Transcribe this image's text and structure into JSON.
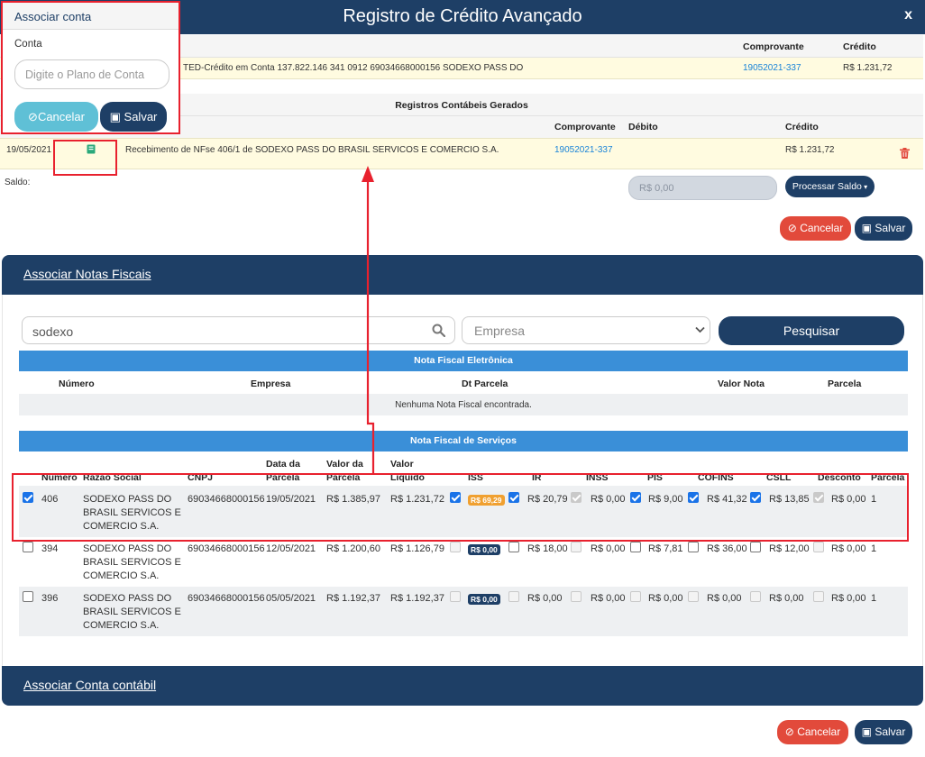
{
  "window": {
    "title": "Registro de Crédito Avançado",
    "close": "x"
  },
  "popup": {
    "title": "Associar conta",
    "field_label": "Conta",
    "placeholder": "Digite o Plano de Conta",
    "cancel": "Cancelar",
    "save": "Salvar"
  },
  "statement": {
    "headers": {
      "comprovante": "Comprovante",
      "credito": "Crédito"
    },
    "row": {
      "description": "TED-Crédito em Conta 137.822.146 341 0912 69034668000156 SODEXO PASS DO",
      "comprovante": "19052021-337",
      "credito": "R$ 1.231,72"
    }
  },
  "registros": {
    "title": "Registros Contábeis Gerados",
    "headers": {
      "comprovante": "Comprovante",
      "debito": "Débito",
      "credito": "Crédito"
    },
    "row": {
      "date": "19/05/2021",
      "description": "Recebimento de NFse 406/1 de SODEXO PASS DO BRASIL SERVICOS E COMERCIO S.A.",
      "comprovante": "19052021-337",
      "credito": "R$ 1.231,72"
    },
    "saldo_label": "Saldo:",
    "saldo_value": "R$ 0,00",
    "processar": "Processar Saldo",
    "cancel": "Cancelar",
    "save": "Salvar"
  },
  "notas": {
    "section_title": "Associar Notas Fiscais",
    "search_value": "sodexo",
    "empresa_placeholder": "Empresa",
    "search_button": "Pesquisar",
    "nfe": {
      "title": "Nota Fiscal Eletrônica",
      "headers": {
        "numero": "Número",
        "empresa": "Empresa",
        "dt_parcela": "Dt Parcela",
        "valor_nota": "Valor Nota",
        "parcela": "Parcela"
      },
      "empty": "Nenhuma Nota Fiscal encontrada."
    },
    "nfs": {
      "title": "Nota Fiscal de Serviços",
      "headers": {
        "numero": "Número",
        "razao": "Razão Social",
        "cnpj": "CNPJ",
        "data_1": "Data da",
        "data_2": "Parcela",
        "valor_parcela_1": "Valor da",
        "valor_parcela_2": "Parcela",
        "valor_liquido_1": "Valor",
        "valor_liquido_2": "Líquido",
        "iss": "ISS",
        "ir": "IR",
        "inss": "INSS",
        "pis": "PIS",
        "cofins": "COFINS",
        "csll": "CSLL",
        "desconto": "Desconto",
        "parcela": "Parcela"
      },
      "rows": [
        {
          "checked": true,
          "numero": "406",
          "razao_1": "SODEXO PASS DO",
          "razao_2": "BRASIL SERVICOS E",
          "razao_3": "COMERCIO S.A.",
          "cnpj": "69034668000156",
          "data": "19/05/2021",
          "valor_parcela": "R$ 1.385,97",
          "valor_liquido": "R$ 1.231,72",
          "iss_badge": "R$ 69,29",
          "ir": "R$ 20,79",
          "inss": "R$ 0,00",
          "pis": "R$ 9,00",
          "cofins": "R$ 41,32",
          "csll": "R$ 13,85",
          "desconto": "R$ 0,00",
          "parcela": "1"
        },
        {
          "checked": false,
          "numero": "394",
          "razao_1": "SODEXO PASS DO",
          "razao_2": "BRASIL SERVICOS E",
          "razao_3": "COMERCIO S.A.",
          "cnpj": "69034668000156",
          "data": "12/05/2021",
          "valor_parcela": "R$ 1.200,60",
          "valor_liquido": "R$ 1.126,79",
          "iss_badge": "R$ 0,00",
          "ir": "R$ 18,00",
          "inss": "R$ 0,00",
          "pis": "R$ 7,81",
          "cofins": "R$ 36,00",
          "csll": "R$ 12,00",
          "desconto": "R$ 0,00",
          "parcela": "1"
        },
        {
          "checked": false,
          "numero": "396",
          "razao_1": "SODEXO PASS DO",
          "razao_2": "BRASIL SERVICOS E",
          "razao_3": "COMERCIO S.A.",
          "cnpj": "69034668000156",
          "data": "05/05/2021",
          "valor_parcela": "R$ 1.192,37",
          "valor_liquido": "R$ 1.192,37",
          "iss_badge": "R$ 0,00",
          "ir": "R$ 0,00",
          "inss": "R$ 0,00",
          "pis": "R$ 0,00",
          "cofins": "R$ 0,00",
          "csll": "R$ 0,00",
          "desconto": "R$ 0,00",
          "parcela": "1"
        }
      ]
    }
  },
  "conta_contabil": {
    "section_title": "Associar Conta contábil",
    "cancel": "Cancelar",
    "save": "Salvar"
  }
}
